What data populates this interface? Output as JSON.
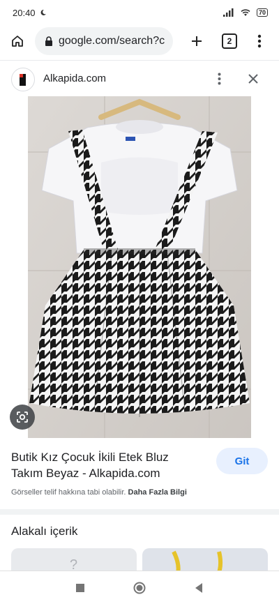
{
  "status_bar": {
    "time": "20:40",
    "battery": "70"
  },
  "browser": {
    "url": "google.com/search?c",
    "tab_count": "2"
  },
  "site": {
    "name": "Alkapida.com"
  },
  "result": {
    "title": "Butik Kız Çocuk İkili Etek Bluz Takım Beyaz - Alkapida.com",
    "go_label": "Git",
    "copyright_text": "Görseller telif hakkına tabi olabilir.",
    "more_info_link": "Daha Fazla Bilgi"
  },
  "related": {
    "title": "Alakalı içerik"
  },
  "icons": {
    "home": "home-icon",
    "lock": "lock-icon",
    "plus": "plus-icon",
    "tabs": "tabs-icon",
    "menu": "more-vert-icon",
    "close": "close-icon",
    "lens": "lens-icon",
    "nav_recents": "square-icon",
    "nav_home": "circle-icon",
    "nav_back": "triangle-back-icon"
  },
  "colors": {
    "accent": "#1a73e8",
    "button_bg": "#e8f0fe",
    "houndstooth_dark": "#1b1b1b"
  }
}
